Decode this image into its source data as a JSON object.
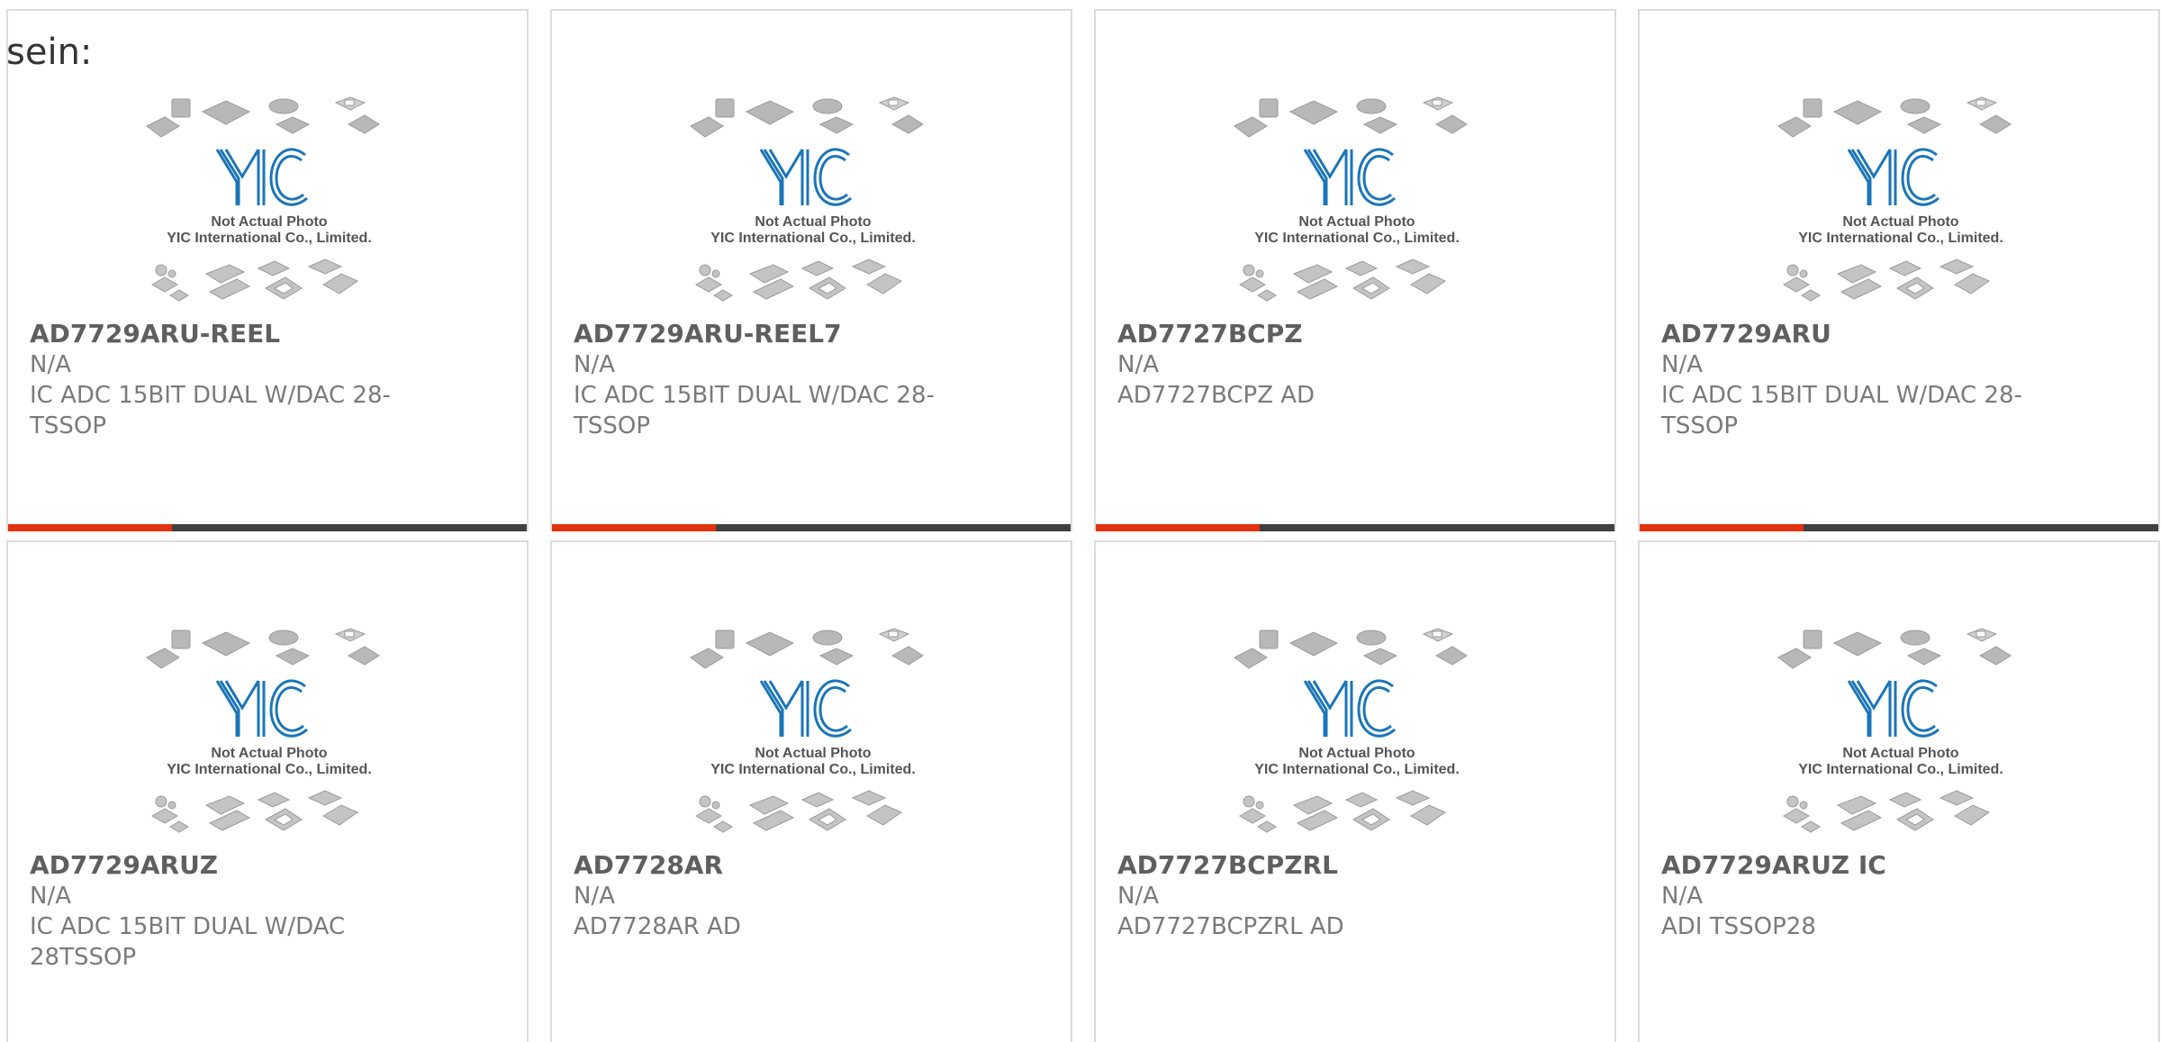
{
  "lead_text": "sein:",
  "photo_caption": {
    "line1": "Not Actual Photo",
    "line2": "YIC International Co., Limited.",
    "logo_text": "YIC"
  },
  "colors": {
    "accent": "#e0330f",
    "bar_dark": "#404040",
    "logo_blue": "#1a75b8"
  },
  "products": [
    {
      "part": "AD7729ARU-REEL",
      "mfr": "N/A",
      "desc": "IC ADC 15BIT DUAL W/DAC 28-TSSOP"
    },
    {
      "part": "AD7729ARU-REEL7",
      "mfr": "N/A",
      "desc": "IC ADC 15BIT DUAL W/DAC 28-TSSOP"
    },
    {
      "part": "AD7727BCPZ",
      "mfr": "N/A",
      "desc": "AD7727BCPZ AD"
    },
    {
      "part": "AD7729ARU",
      "mfr": "N/A",
      "desc": "IC ADC 15BIT DUAL W/DAC 28-TSSOP"
    },
    {
      "part": "AD7729ARUZ",
      "mfr": "N/A",
      "desc": "IC ADC 15BIT DUAL W/DAC 28TSSOP"
    },
    {
      "part": "AD7728AR",
      "mfr": "N/A",
      "desc": "AD7728AR AD"
    },
    {
      "part": "AD7727BCPZRL",
      "mfr": "N/A",
      "desc": "AD7727BCPZRL AD"
    },
    {
      "part": "AD7729ARUZ IC",
      "mfr": "N/A",
      "desc": "ADI TSSOP28"
    }
  ]
}
